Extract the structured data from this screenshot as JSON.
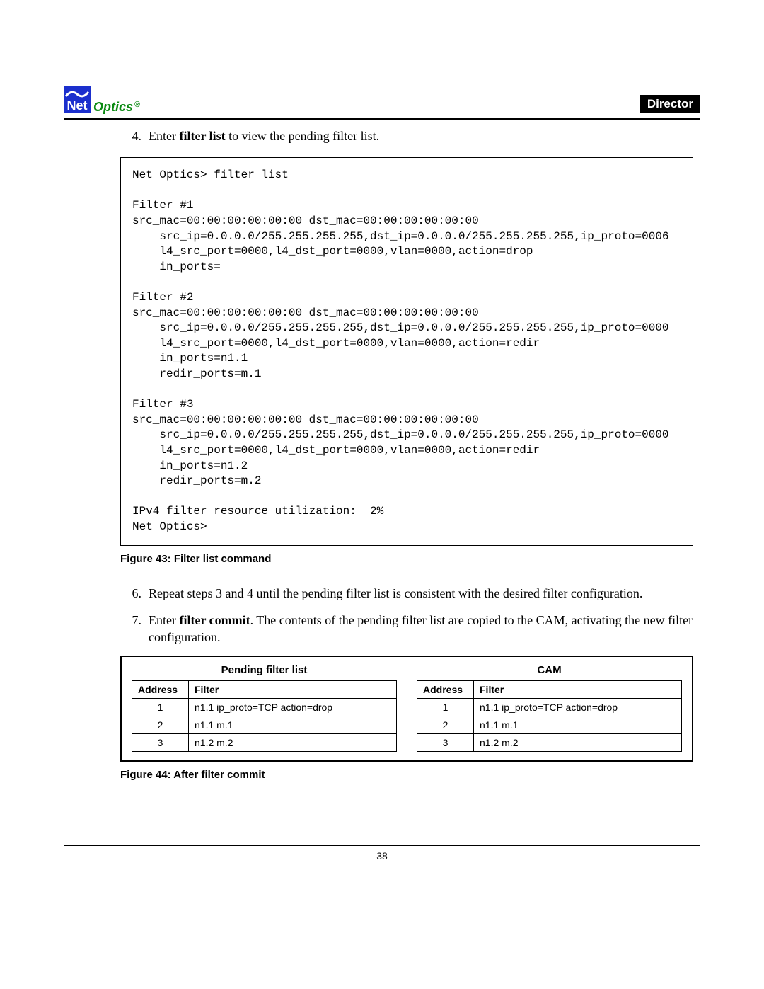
{
  "logo": {
    "net": "Net",
    "optics": "Optics",
    "reg": "®"
  },
  "chapter": "Director",
  "step4_num": "4.",
  "step4_pre": "Enter ",
  "step4_cmd": "filter list",
  "step4_post": " to view the pending filter list.",
  "codebox": "Net Optics> filter list\n\nFilter #1\nsrc_mac=00:00:00:00:00:00 dst_mac=00:00:00:00:00:00\n    src_ip=0.0.0.0/255.255.255.255,dst_ip=0.0.0.0/255.255.255.255,ip_proto=0006\n    l4_src_port=0000,l4_dst_port=0000,vlan=0000,action=drop\n    in_ports=\n\nFilter #2\nsrc_mac=00:00:00:00:00:00 dst_mac=00:00:00:00:00:00\n    src_ip=0.0.0.0/255.255.255.255,dst_ip=0.0.0.0/255.255.255.255,ip_proto=0000\n    l4_src_port=0000,l4_dst_port=0000,vlan=0000,action=redir\n    in_ports=n1.1\n    redir_ports=m.1\n\nFilter #3\nsrc_mac=00:00:00:00:00:00 dst_mac=00:00:00:00:00:00\n    src_ip=0.0.0.0/255.255.255.255,dst_ip=0.0.0.0/255.255.255.255,ip_proto=0000\n    l4_src_port=0000,l4_dst_port=0000,vlan=0000,action=redir\n    in_ports=n1.2\n    redir_ports=m.2\n\nIPv4 filter resource utilization:  2%\nNet Optics>",
  "fig43": "Figure 43: Filter list command",
  "step6_num": "6.",
  "step6_text": "Repeat steps 3 and 4 until the pending filter list is consistent with the desired filter configuration.",
  "step7_num": "7.",
  "step7_pre": "Enter ",
  "step7_cmd": "filter commit",
  "step7_post": ". The contents of the pending filter list are copied to the CAM, activating the new filter configuration.",
  "tables": {
    "left": {
      "title": "Pending filter list",
      "h1": "Address",
      "h2": "Filter",
      "rows": [
        [
          "1",
          "n1.1 ip_proto=TCP action=drop"
        ],
        [
          "2",
          "n1.1 m.1"
        ],
        [
          "3",
          "n1.2 m.2"
        ]
      ]
    },
    "right": {
      "title": "CAM",
      "h1": "Address",
      "h2": "Filter",
      "rows": [
        [
          "1",
          "n1.1 ip_proto=TCP action=drop"
        ],
        [
          "2",
          "n1.1 m.1"
        ],
        [
          "3",
          "n1.2 m.2"
        ]
      ]
    }
  },
  "fig44": "Figure 44: After filter commit",
  "page_num": "38"
}
